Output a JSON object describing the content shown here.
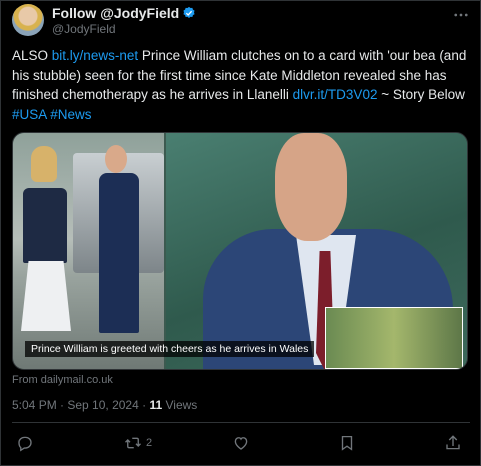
{
  "header": {
    "follow_label": "Follow @JodyField",
    "handle": "@JodyField",
    "verified_icon": "verified-badge-icon",
    "more_icon": "more-icon"
  },
  "tweet": {
    "prefix": "ALSO",
    "link1": "bit.ly/news-net",
    "body": "Prince William clutches on to a card with 'our bea (and his stubble) seen for the first time since Kate Middleton revealed she has finished chemotherapy as he arrives in Llanelli",
    "link2": "dlvr.it/TD3V02",
    "after_link2": "~ Story Below",
    "hashtag1": "#USA",
    "hashtag2": "#News"
  },
  "media": {
    "caption": "Prince William is greeted with cheers as he arrives in Wales"
  },
  "source": "From dailymail.co.uk",
  "meta": {
    "time": "5:04 PM",
    "separator1": " · ",
    "date": "Sep 10, 2024",
    "separator2": " · ",
    "views_count": "11",
    "views_label": "Views"
  },
  "actions": {
    "reply_icon": "reply-icon",
    "retweet_icon": "retweet-icon",
    "retweet_count": "2",
    "like_icon": "heart-icon",
    "bookmark_icon": "bookmark-icon",
    "share_icon": "share-icon"
  },
  "colors": {
    "background": "#000000",
    "text": "#e7e9ea",
    "secondary": "#71767b",
    "link": "#1d9bf0",
    "border": "#2f3336"
  }
}
